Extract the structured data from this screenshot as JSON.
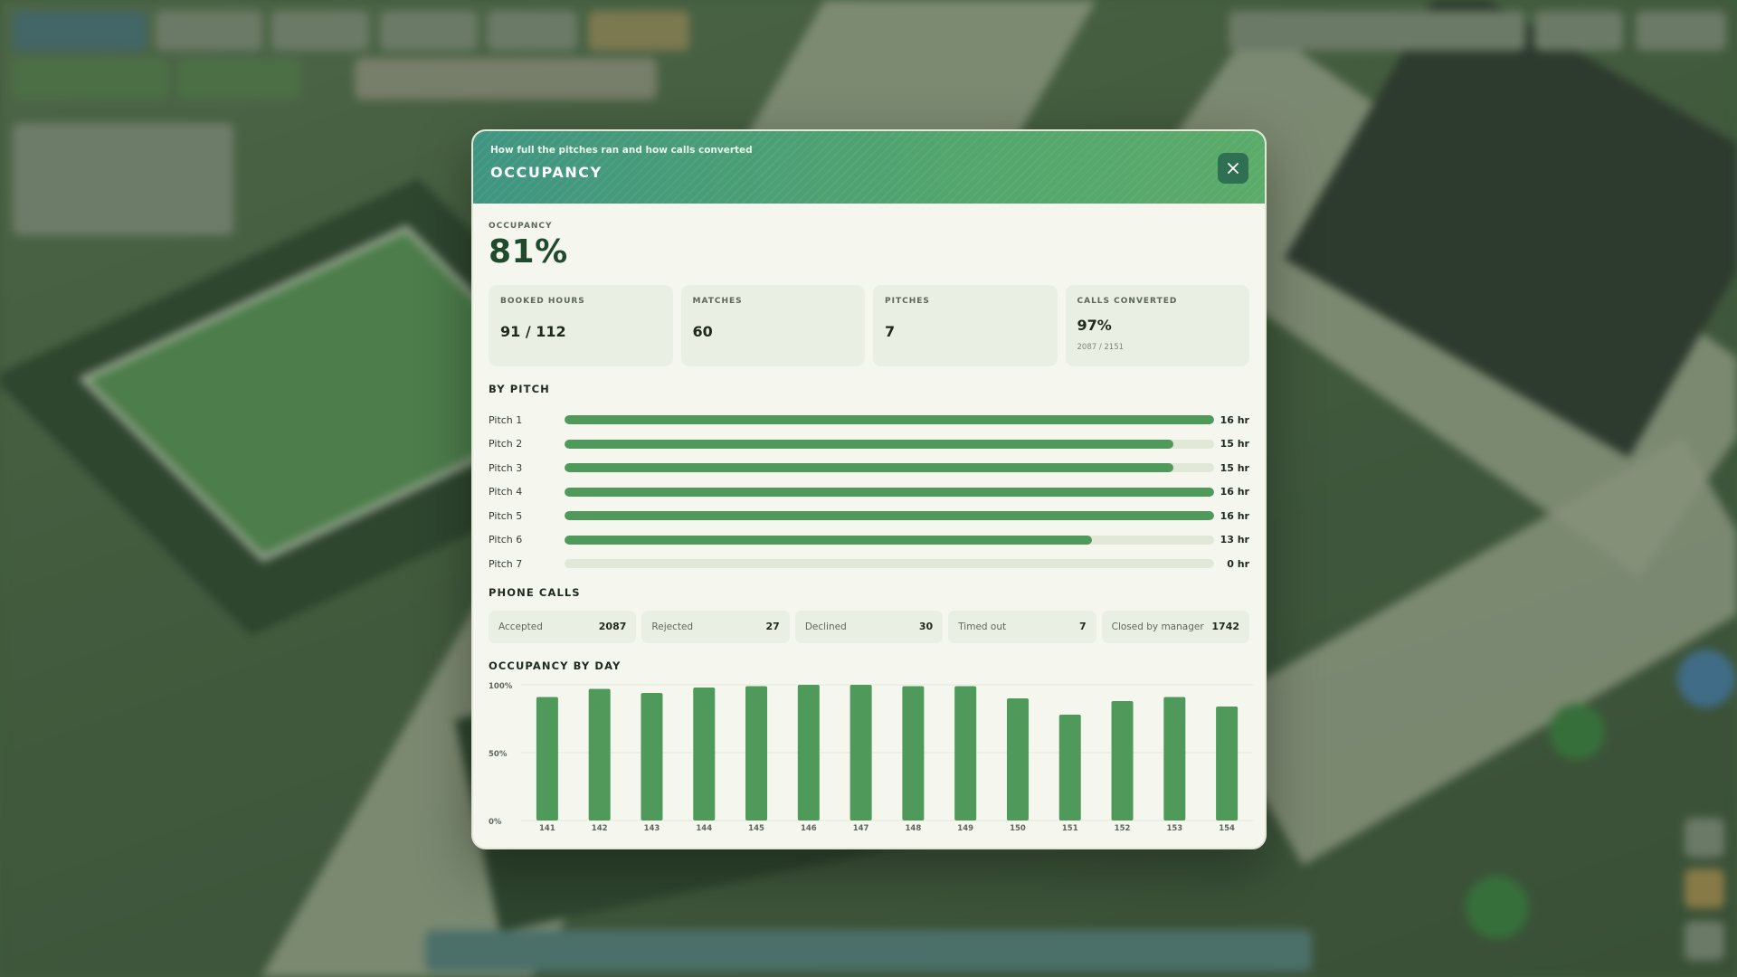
{
  "modal": {
    "subtitle": "How full the pitches ran and how calls converted",
    "title": "OCCUPANCY"
  },
  "occupancy": {
    "label": "OCCUPANCY",
    "value": "81%"
  },
  "stats": [
    {
      "label": "BOOKED HOURS",
      "value": "91 / 112"
    },
    {
      "label": "MATCHES",
      "value": "60"
    },
    {
      "label": "PITCHES",
      "value": "7"
    },
    {
      "label": "CALLS CONVERTED",
      "value": "97%",
      "sub": "2087 / 2151"
    }
  ],
  "by_pitch": {
    "title": "BY PITCH",
    "pitches": [
      {
        "name": "Pitch 1",
        "hours": "16 hr",
        "fill": 1.0
      },
      {
        "name": "Pitch 2",
        "hours": "15 hr",
        "fill": 0.9375
      },
      {
        "name": "Pitch 3",
        "hours": "15 hr",
        "fill": 0.9375
      },
      {
        "name": "Pitch 4",
        "hours": "16 hr",
        "fill": 1.0
      },
      {
        "name": "Pitch 5",
        "hours": "16 hr",
        "fill": 1.0
      },
      {
        "name": "Pitch 6",
        "hours": "13 hr",
        "fill": 0.8125
      },
      {
        "name": "Pitch 7",
        "hours": "0 hr",
        "fill": 0
      }
    ]
  },
  "phone_calls": {
    "title": "PHONE CALLS",
    "items": [
      {
        "label": "Accepted",
        "value": "2087"
      },
      {
        "label": "Rejected",
        "value": "27"
      },
      {
        "label": "Declined",
        "value": "30"
      },
      {
        "label": "Timed out",
        "value": "7"
      },
      {
        "label": "Closed by manager",
        "value": "1742"
      }
    ]
  },
  "occupancy_by_day": {
    "title": "OCCUPANCY BY DAY"
  },
  "colors": {
    "accent": "#4f9a5a",
    "header_start": "#3f9582",
    "header_end": "#5bab6a",
    "close_button": "#2f7052"
  },
  "icons": {
    "close": "close-icon"
  },
  "chart_data": {
    "type": "bar",
    "title": "OCCUPANCY BY DAY",
    "categories": [
      "141",
      "142",
      "143",
      "144",
      "145",
      "146",
      "147",
      "148",
      "149",
      "150",
      "151",
      "152",
      "153",
      "154"
    ],
    "values": [
      91,
      97,
      94,
      98,
      99,
      100,
      100,
      99,
      99,
      90,
      78,
      88,
      91,
      84
    ],
    "yticks": [
      "100%",
      "50%",
      "0%"
    ],
    "ylim": [
      0,
      100
    ],
    "grid": true
  }
}
